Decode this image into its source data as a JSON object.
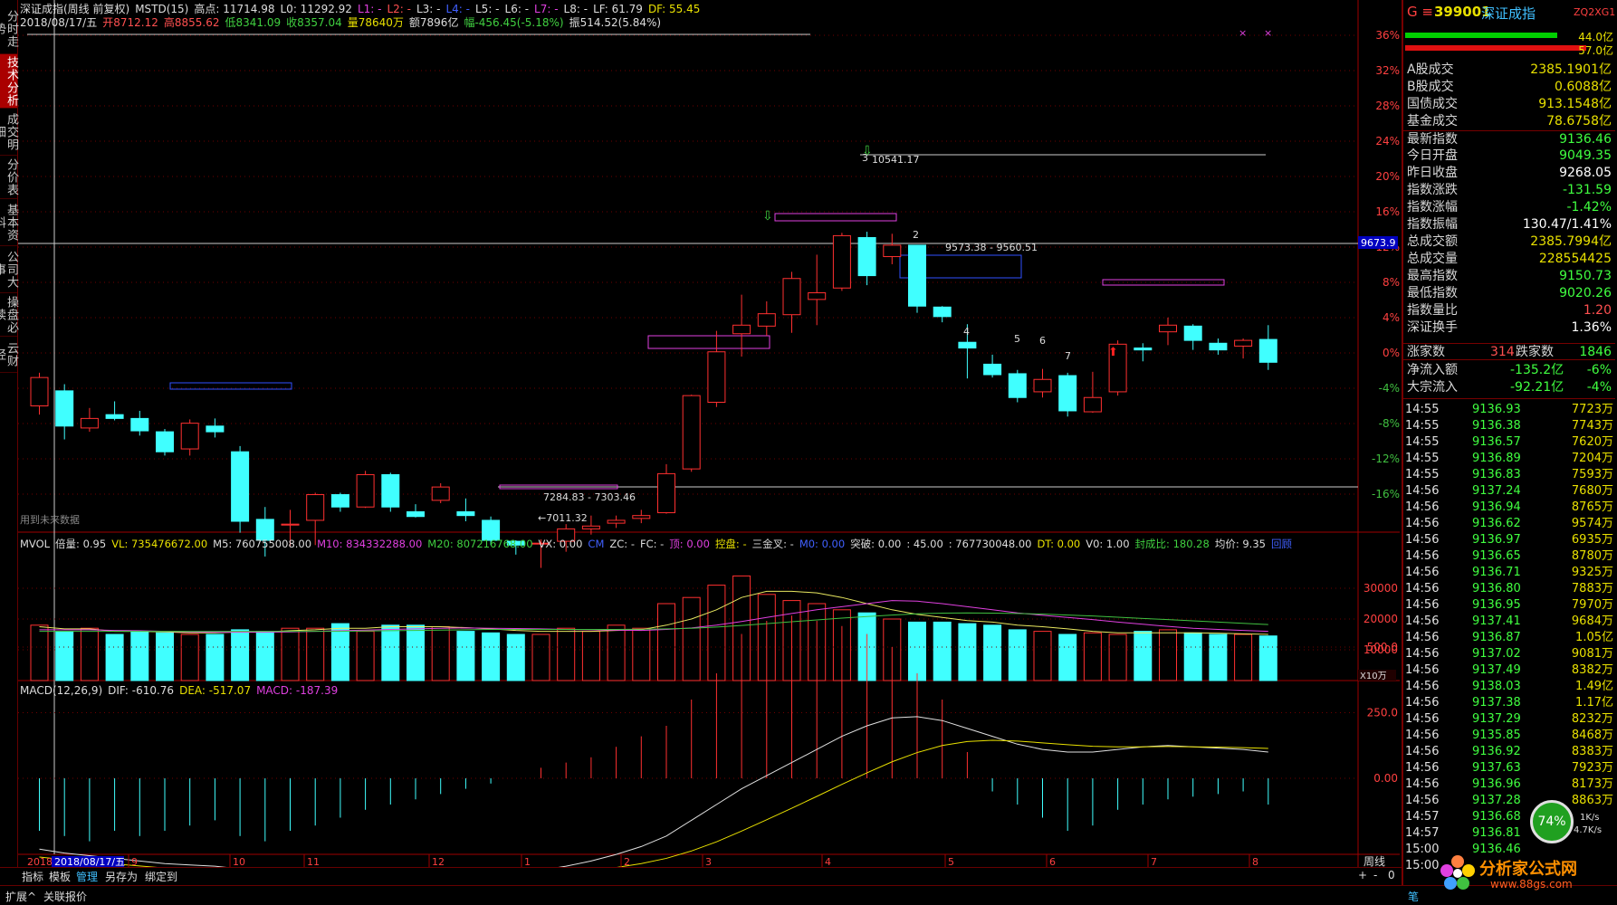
{
  "tabs_left": [
    "分时走势",
    "技术分析",
    "成交明细",
    "分价表",
    "基本资料",
    "公司大事",
    "操盘必读",
    "云财经"
  ],
  "active_tab": 1,
  "header": {
    "line1": [
      {
        "text": "深证成指(周线 前复权)",
        "cls": "w"
      },
      {
        "text": "MSTD(15)",
        "cls": "w"
      },
      {
        "text": "高点: 11714.98",
        "cls": "w"
      },
      {
        "text": "L0: 11292.92",
        "cls": "w"
      },
      {
        "text": "L1: -",
        "cls": "m"
      },
      {
        "text": "L2: -",
        "cls": "r"
      },
      {
        "text": "L3: -",
        "cls": "w"
      },
      {
        "text": "L4: -",
        "cls": "b"
      },
      {
        "text": "L5: -",
        "cls": "w"
      },
      {
        "text": "L6: -",
        "cls": "w"
      },
      {
        "text": "L7: -",
        "cls": "m"
      },
      {
        "text": "L8: -",
        "cls": "w"
      },
      {
        "text": "LF: 61.79",
        "cls": "w"
      },
      {
        "text": "DF: 55.45",
        "cls": "y"
      }
    ],
    "line2": [
      {
        "text": "2018/08/17/五",
        "cls": "w"
      },
      {
        "text": "开8712.12",
        "cls": "r"
      },
      {
        "text": "高8855.62",
        "cls": "r"
      },
      {
        "text": "低8341.09",
        "cls": "g"
      },
      {
        "text": "收8357.04",
        "cls": "g"
      },
      {
        "text": "量78640万",
        "cls": "y"
      },
      {
        "text": "额7896亿",
        "cls": "w"
      },
      {
        "text": "幅-456.45(-5.18%)",
        "cls": "g"
      },
      {
        "text": "振514.52(5.84%)",
        "cls": "w"
      }
    ]
  },
  "price_axis_labels": [
    "36%",
    "32%",
    "28%",
    "24%",
    "20%",
    "16%",
    "12%",
    "8%",
    "4%",
    "0%",
    "-4%",
    "-8%",
    "-12%",
    "-16%"
  ],
  "price_cursor_label": "9673.9",
  "annotations": {
    "high_label": "10541.17",
    "box_label1": "9573.38 - 9560.51",
    "box_label2": "7284.83 - 7303.46",
    "low_label": "7011.32",
    "future_note": "用到未来数据",
    "wave_numbers": [
      "2",
      "4",
      "5",
      "6",
      "7"
    ],
    "wave_number_top": "3"
  },
  "volume_header": [
    {
      "text": "MVOL",
      "cls": "w"
    },
    {
      "text": "倍量: 0.95",
      "cls": "w"
    },
    {
      "text": "VL: 735476672.00",
      "cls": "y"
    },
    {
      "text": "M5: 760755008.00",
      "cls": "w"
    },
    {
      "text": "M10: 834332288.00",
      "cls": "m"
    },
    {
      "text": "M20: 807216768.00",
      "cls": "g"
    },
    {
      "text": "VX: 0.00",
      "cls": "w"
    },
    {
      "text": "CM",
      "cls": "b"
    },
    {
      "text": "ZC: -",
      "cls": "w"
    },
    {
      "text": "FC: -",
      "cls": "w"
    },
    {
      "text": "顶: 0.00",
      "cls": "m"
    },
    {
      "text": "控盘: -",
      "cls": "y"
    },
    {
      "text": "三金叉: -",
      "cls": "w"
    },
    {
      "text": "M0: 0.00",
      "cls": "b"
    },
    {
      "text": "突破: 0.00",
      "cls": "w"
    },
    {
      "text": ": 45.00",
      "cls": "w"
    },
    {
      "text": ": 767730048.00",
      "cls": "w"
    },
    {
      "text": "DT: 0.00",
      "cls": "y"
    },
    {
      "text": "V0: 1.00",
      "cls": "w"
    },
    {
      "text": "封成比: 180.28",
      "cls": "g"
    },
    {
      "text": "均价: 9.35",
      "cls": "w"
    },
    {
      "text": "回顾",
      "cls": "b"
    }
  ],
  "volume_axis_labels": [
    "30000",
    "20000",
    "10000"
  ],
  "volume_unit": "X10万",
  "macd_header": [
    {
      "text": "MACD(12,26,9)",
      "cls": "w"
    },
    {
      "text": "DIF: -610.76",
      "cls": "w"
    },
    {
      "text": "DEA: -517.07",
      "cls": "y"
    },
    {
      "text": "MACD: -187.39",
      "cls": "m"
    }
  ],
  "macd_axis_labels": [
    "500.0",
    "250.0",
    "0.00"
  ],
  "date_axis": {
    "cursor_date": "2018/08/17/五",
    "year": "2018",
    "months": [
      "9",
      "10",
      "11",
      "12",
      "1",
      "2",
      "3",
      "4",
      "5",
      "6",
      "7",
      "8"
    ],
    "period": "周线"
  },
  "bottom_tabs": [
    "指标",
    "模板",
    "管理",
    "另存为",
    "绑定到"
  ],
  "bottom_right": [
    "+",
    "-",
    "0"
  ],
  "status": [
    "扩展^",
    "关联报价"
  ],
  "right_panel": {
    "code": "399001",
    "name": "深证成指",
    "source": "ZQ2XG1",
    "bar_vals": [
      "44.0亿",
      "57.0亿"
    ],
    "rows": [
      {
        "k": "A股成交",
        "v": "2385.1901亿",
        "c": "#e8e000"
      },
      {
        "k": "B股成交",
        "v": "0.6088亿",
        "c": "#e8e000"
      },
      {
        "k": "国债成交",
        "v": "913.1548亿",
        "c": "#e8e000"
      },
      {
        "k": "基金成交",
        "v": "78.6758亿",
        "c": "#e8e000"
      },
      {
        "k": "最新指数",
        "v": "9136.46",
        "c": "#40ff40"
      },
      {
        "k": "今日开盘",
        "v": "9049.35",
        "c": "#40ff40"
      },
      {
        "k": "昨日收盘",
        "v": "9268.05",
        "c": "#ffffff"
      },
      {
        "k": "指数涨跌",
        "v": "-131.59",
        "c": "#40ff40"
      },
      {
        "k": "指数涨幅",
        "v": "-1.42%",
        "c": "#40ff40"
      },
      {
        "k": "指数振幅",
        "v": "130.47/1.41%",
        "c": "#ffffff"
      },
      {
        "k": "总成交额",
        "v": "2385.7994亿",
        "c": "#e8e000"
      },
      {
        "k": "总成交量",
        "v": "228554425",
        "c": "#e8e000"
      },
      {
        "k": "最高指数",
        "v": "9150.73",
        "c": "#40ff40"
      },
      {
        "k": "最低指数",
        "v": "9020.26",
        "c": "#40ff40"
      },
      {
        "k": "指数量比",
        "v": "1.20",
        "c": "#ff5050"
      },
      {
        "k": "深证换手",
        "v": "1.36%",
        "c": "#ffffff"
      }
    ],
    "updown": {
      "up_label": "涨家数",
      "up": "314",
      "down_label": "跌家数",
      "down": "1846"
    },
    "flows": [
      {
        "k": "净流入额",
        "v": "-135.2亿",
        "p": "-6%"
      },
      {
        "k": "大宗流入",
        "v": "-92.21亿",
        "p": "-4%"
      }
    ],
    "ticks": [
      {
        "t": "14:55",
        "p": "9136.93",
        "q": "7723万"
      },
      {
        "t": "14:55",
        "p": "9136.38",
        "q": "7743万"
      },
      {
        "t": "14:55",
        "p": "9136.57",
        "q": "7620万"
      },
      {
        "t": "14:55",
        "p": "9136.89",
        "q": "7204万"
      },
      {
        "t": "14:55",
        "p": "9136.83",
        "q": "7593万"
      },
      {
        "t": "14:56",
        "p": "9137.24",
        "q": "7680万"
      },
      {
        "t": "14:56",
        "p": "9136.94",
        "q": "8765万"
      },
      {
        "t": "14:56",
        "p": "9136.62",
        "q": "9574万"
      },
      {
        "t": "14:56",
        "p": "9136.97",
        "q": "6935万"
      },
      {
        "t": "14:56",
        "p": "9136.65",
        "q": "8780万"
      },
      {
        "t": "14:56",
        "p": "9136.71",
        "q": "9325万"
      },
      {
        "t": "14:56",
        "p": "9136.80",
        "q": "7883万"
      },
      {
        "t": "14:56",
        "p": "9136.95",
        "q": "7970万"
      },
      {
        "t": "14:56",
        "p": "9137.41",
        "q": "9684万"
      },
      {
        "t": "14:56",
        "p": "9136.87",
        "q": "1.05亿"
      },
      {
        "t": "14:56",
        "p": "9137.02",
        "q": "9081万"
      },
      {
        "t": "14:56",
        "p": "9137.49",
        "q": "8382万"
      },
      {
        "t": "14:56",
        "p": "9138.03",
        "q": "1.49亿"
      },
      {
        "t": "14:56",
        "p": "9137.38",
        "q": "1.17亿"
      },
      {
        "t": "14:56",
        "p": "9137.29",
        "q": "8232万"
      },
      {
        "t": "14:56",
        "p": "9135.85",
        "q": "8468万"
      },
      {
        "t": "14:56",
        "p": "9136.92",
        "q": "8383万"
      },
      {
        "t": "14:56",
        "p": "9137.63",
        "q": "7923万"
      },
      {
        "t": "14:56",
        "p": "9136.96",
        "q": "8173万"
      },
      {
        "t": "14:56",
        "p": "9137.28",
        "q": "8863万"
      },
      {
        "t": "14:57",
        "p": "9136.68",
        "q": ""
      },
      {
        "t": "14:57",
        "p": "9136.81",
        "q": ""
      },
      {
        "t": "15:00",
        "p": "9136.46",
        "q": ""
      },
      {
        "t": "15:00",
        "p": "",
        "q": ""
      }
    ],
    "gauge": "74%",
    "speeds": [
      "1K/s",
      "4.7K/s"
    ],
    "watermark": "分析家公式网",
    "watermark_url": "www.88gs.com",
    "status_item": "笔"
  },
  "candles": [
    {
      "o": 8712,
      "c": 9010,
      "h": 9060,
      "l": 8620
    },
    {
      "o": 8870,
      "c": 8500,
      "h": 8940,
      "l": 8360
    },
    {
      "o": 8480,
      "c": 8580,
      "h": 8690,
      "l": 8440
    },
    {
      "o": 8620,
      "c": 8580,
      "h": 8760,
      "l": 8560
    },
    {
      "o": 8580,
      "c": 8450,
      "h": 8660,
      "l": 8400
    },
    {
      "o": 8440,
      "c": 8230,
      "h": 8470,
      "l": 8190
    },
    {
      "o": 8260,
      "c": 8530,
      "h": 8570,
      "l": 8190
    },
    {
      "o": 8500,
      "c": 8440,
      "h": 8580,
      "l": 8380
    },
    {
      "o": 8230,
      "c": 7500,
      "h": 8290,
      "l": 7380
    },
    {
      "o": 7520,
      "c": 7300,
      "h": 7650,
      "l": 7130
    },
    {
      "o": 7460,
      "c": 7470,
      "h": 7620,
      "l": 7240
    },
    {
      "o": 7510,
      "c": 7780,
      "h": 7800,
      "l": 7250
    },
    {
      "o": 7780,
      "c": 7650,
      "h": 7800,
      "l": 7600
    },
    {
      "o": 7650,
      "c": 7990,
      "h": 8030,
      "l": 7640
    },
    {
      "o": 7990,
      "c": 7650,
      "h": 8010,
      "l": 7600
    },
    {
      "o": 7600,
      "c": 7550,
      "h": 7680,
      "l": 7540
    },
    {
      "o": 7720,
      "c": 7860,
      "h": 7900,
      "l": 7690
    },
    {
      "o": 7600,
      "c": 7560,
      "h": 7740,
      "l": 7500
    },
    {
      "o": 7510,
      "c": 7300,
      "h": 7550,
      "l": 7250
    },
    {
      "o": 7290,
      "c": 7250,
      "h": 7300,
      "l": 7150
    },
    {
      "o": 7270,
      "c": 7270,
      "h": 7310,
      "l": 7011
    },
    {
      "o": 7290,
      "c": 7420,
      "h": 7470,
      "l": 7180
    },
    {
      "o": 7420,
      "c": 7450,
      "h": 7560,
      "l": 7360
    },
    {
      "o": 7480,
      "c": 7510,
      "h": 7560,
      "l": 7430
    },
    {
      "o": 7530,
      "c": 7560,
      "h": 7620,
      "l": 7480
    },
    {
      "o": 7590,
      "c": 8000,
      "h": 8100,
      "l": 7580
    },
    {
      "o": 8050,
      "c": 8820,
      "h": 8830,
      "l": 8020
    },
    {
      "o": 8750,
      "c": 9280,
      "h": 9500,
      "l": 8700
    },
    {
      "o": 9470,
      "c": 9560,
      "h": 9880,
      "l": 9230
    },
    {
      "o": 9550,
      "c": 9680,
      "h": 9810,
      "l": 9450
    },
    {
      "o": 9670,
      "c": 10050,
      "h": 10120,
      "l": 9480
    },
    {
      "o": 9830,
      "c": 9900,
      "h": 10300,
      "l": 9560
    },
    {
      "o": 9950,
      "c": 10500,
      "h": 10530,
      "l": 9920
    },
    {
      "o": 10480,
      "c": 10080,
      "h": 10541,
      "l": 9980
    },
    {
      "o": 10280,
      "c": 10400,
      "h": 10520,
      "l": 10200
    },
    {
      "o": 10400,
      "c": 9760,
      "h": 10400,
      "l": 9690
    },
    {
      "o": 9750,
      "c": 9650,
      "h": 9760,
      "l": 9590
    },
    {
      "o": 9380,
      "c": 9320,
      "h": 9570,
      "l": 9000
    },
    {
      "o": 9150,
      "c": 9040,
      "h": 9250,
      "l": 9010
    },
    {
      "o": 9050,
      "c": 8800,
      "h": 9090,
      "l": 8750
    },
    {
      "o": 8860,
      "c": 8990,
      "h": 9100,
      "l": 8800
    },
    {
      "o": 9030,
      "c": 8660,
      "h": 9060,
      "l": 8600
    },
    {
      "o": 8650,
      "c": 8800,
      "h": 9070,
      "l": 8640
    },
    {
      "o": 8860,
      "c": 9360,
      "h": 9400,
      "l": 8820
    },
    {
      "o": 9320,
      "c": 9300,
      "h": 9370,
      "l": 9180
    },
    {
      "o": 9490,
      "c": 9560,
      "h": 9640,
      "l": 9350
    },
    {
      "o": 9550,
      "c": 9400,
      "h": 9570,
      "l": 9300
    },
    {
      "o": 9370,
      "c": 9300,
      "h": 9420,
      "l": 9250
    },
    {
      "o": 9340,
      "c": 9400,
      "h": 9420,
      "l": 9210
    },
    {
      "o": 9410,
      "c": 9170,
      "h": 9560,
      "l": 9090
    }
  ],
  "volumes": [
    180,
    160,
    170,
    150,
    160,
    155,
    150,
    150,
    165,
    160,
    170,
    170,
    185,
    160,
    180,
    180,
    175,
    160,
    155,
    150,
    150,
    170,
    160,
    180,
    170,
    250,
    270,
    310,
    340,
    280,
    260,
    250,
    230,
    220,
    200,
    190,
    190,
    185,
    180,
    165,
    160,
    150,
    155,
    150,
    160,
    165,
    155,
    150,
    150,
    145
  ],
  "macd_vals": [
    -20,
    -22,
    -24,
    -20,
    -22,
    -20,
    -18,
    -16,
    -22,
    -24,
    -20,
    -18,
    -15,
    -12,
    -10,
    -8,
    -6,
    -4,
    -2,
    0,
    4,
    6,
    8,
    12,
    16,
    20,
    30,
    40,
    55,
    60,
    62,
    60,
    58,
    55,
    50,
    40,
    30,
    10,
    -5,
    -10,
    -15,
    -20,
    -18,
    -12,
    -10,
    -8,
    -7,
    -6,
    -5,
    -10
  ],
  "dif_vals": [
    -270,
    -285,
    -295,
    -305,
    -315,
    -325,
    -330,
    -335,
    -345,
    -360,
    -375,
    -385,
    -390,
    -392,
    -390,
    -388,
    -380,
    -370,
    -365,
    -358,
    -350,
    -335,
    -315,
    -290,
    -260,
    -220,
    -160,
    -100,
    -40,
    10,
    60,
    110,
    160,
    200,
    230,
    235,
    220,
    190,
    160,
    130,
    110,
    100,
    100,
    110,
    120,
    125,
    120,
    115,
    110,
    100
  ],
  "dea_vals": [
    -300,
    -310,
    -318,
    -326,
    -334,
    -342,
    -350,
    -356,
    -362,
    -368,
    -374,
    -380,
    -384,
    -388,
    -390,
    -390,
    -389,
    -386,
    -382,
    -377,
    -371,
    -363,
    -353,
    -340,
    -325,
    -305,
    -277,
    -242,
    -201,
    -158,
    -114,
    -69,
    -23,
    21,
    63,
    98,
    125,
    140,
    145,
    142,
    135,
    128,
    122,
    120,
    120,
    121,
    120,
    119,
    117,
    114
  ],
  "ma5_vol": [
    175,
    168,
    168,
    160,
    160,
    158,
    155,
    155,
    158,
    158,
    162,
    165,
    170,
    170,
    175,
    175,
    175,
    172,
    168,
    163,
    160,
    160,
    160,
    163,
    165,
    180,
    200,
    230,
    270,
    290,
    290,
    285,
    270,
    250,
    230,
    215,
    205,
    195,
    190,
    180,
    175,
    168,
    160,
    155,
    155,
    155,
    155,
    154,
    152,
    150
  ],
  "ma10_vol": [
    165,
    165,
    165,
    163,
    162,
    160,
    158,
    157,
    157,
    157,
    158,
    160,
    162,
    164,
    166,
    168,
    170,
    171,
    170,
    169,
    168,
    166,
    165,
    164,
    163,
    166,
    171,
    180,
    192,
    205,
    218,
    230,
    240,
    250,
    260,
    258,
    250,
    240,
    230,
    220,
    212,
    205,
    198,
    190,
    183,
    176,
    170,
    166,
    163,
    160
  ],
  "ma20_vol": [
    160,
    160,
    160,
    160,
    160,
    160,
    160,
    160,
    160,
    160,
    160,
    160,
    160,
    161,
    162,
    163,
    164,
    165,
    166,
    166,
    166,
    166,
    166,
    166,
    167,
    168,
    170,
    174,
    179,
    185,
    191,
    197,
    203,
    208,
    213,
    217,
    219,
    220,
    219,
    218,
    216,
    213,
    210,
    206,
    202,
    198,
    194,
    190,
    186,
    182
  ]
}
